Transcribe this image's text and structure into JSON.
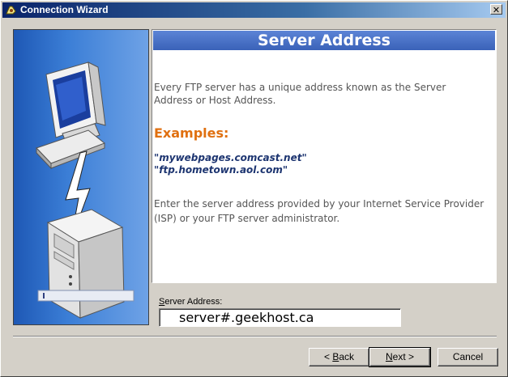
{
  "window": {
    "title": "Connection Wizard",
    "close_label": "✕"
  },
  "content": {
    "header": "Server Address",
    "intro": "Every FTP server has a unique address known as the Server Address or Host Address.",
    "examples_heading": "Examples:",
    "examples": [
      "\"mywebpages.comcast.net\"",
      "\"ftp.hometown.aol.com\""
    ],
    "instruction": "Enter the server address provided by your Internet Service Provider (ISP) or your FTP server administrator."
  },
  "form": {
    "server_label_accel": "S",
    "server_label_rest": "erver Address:",
    "server_value": "server#.geekhost.ca"
  },
  "buttons": {
    "back_prefix": "< ",
    "back_accel": "B",
    "back_rest": "ack",
    "next_accel": "N",
    "next_rest": "ext >",
    "cancel": "Cancel"
  },
  "icons": {
    "title": "wizard-app-icon",
    "computer": "desktop-computer-icon",
    "lightning": "lightning-bolt-icon",
    "server": "server-tower-icon"
  }
}
